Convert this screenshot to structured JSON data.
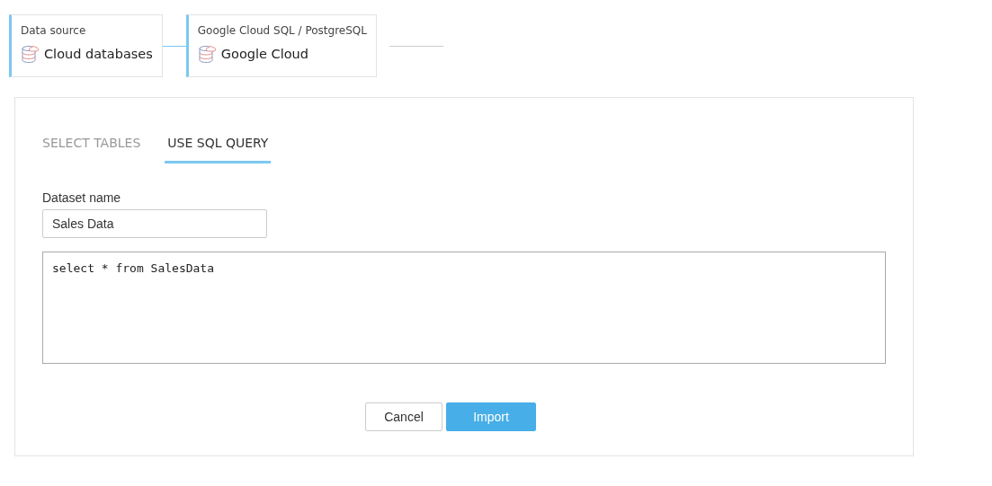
{
  "breadcrumb": [
    {
      "label": "Data source",
      "value": "Cloud databases"
    },
    {
      "label": "Google Cloud SQL / PostgreSQL",
      "value": "Google Cloud"
    }
  ],
  "tabs": [
    {
      "label": "SELECT TABLES",
      "selected": false
    },
    {
      "label": "USE SQL QUERY",
      "selected": true
    }
  ],
  "dataset_name": {
    "label": "Dataset name",
    "value": "Sales Data"
  },
  "query": {
    "value": "select * from SalesData"
  },
  "buttons": [
    {
      "label": "Cancel",
      "kind": "secondary"
    },
    {
      "label": "Import",
      "kind": "primary"
    }
  ]
}
